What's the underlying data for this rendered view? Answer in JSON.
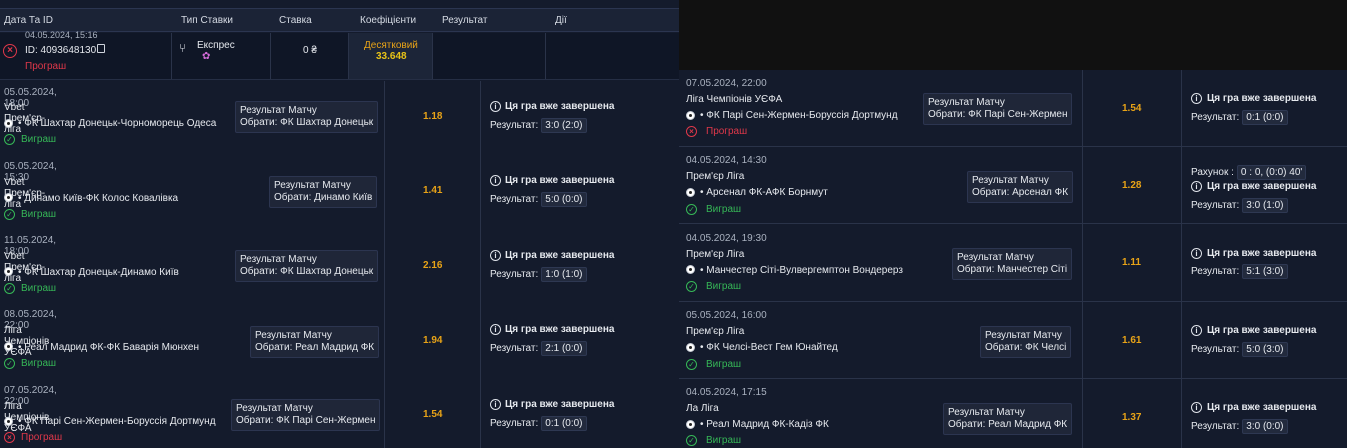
{
  "headers": {
    "date_id": "Дата Та ID",
    "bet_type": "Тип Ставки",
    "stake": "Ставка",
    "coef": "Коефіцієнти",
    "result": "Результат",
    "actions": "Дії"
  },
  "summary": {
    "date": "04.05.2024, 15:16",
    "id": "ID: 4093648130",
    "status": "Програш",
    "type": "Експрес",
    "stake": "0 ₴",
    "coef_label": "Десятковий",
    "coef_value": "33.648"
  },
  "common": {
    "market": "Результат Матчу",
    "choice_prefix": "Обрати:",
    "finished": "Ця гра вже завершена",
    "result_label": "Результат:",
    "win": "Виграш",
    "lose": "Програш"
  },
  "left_rows": [
    {
      "date": "05.05.2024, 18:00",
      "league": "Vbet Прем'єр-ліга",
      "teams": "• ФК Шахтар Донецьк-Чорноморець Одеса",
      "choice": "Обрати: ФК Шахтар Донецьк",
      "odds": "1.18",
      "score": "3:0 (2:0)",
      "status": "Виграш",
      "win": true
    },
    {
      "date": "05.05.2024, 15:30",
      "league": "Vbet Прем'єр-ліга",
      "teams": "• Динамо Київ-ФК Колос Ковалівка",
      "choice": "Обрати: Динамо Київ",
      "odds": "1.41",
      "score": "5:0 (0:0)",
      "status": "Виграш",
      "win": true
    },
    {
      "date": "11.05.2024, 18:00",
      "league": "Vbet Прем'єр-ліга",
      "teams": "• ФК Шахтар Донецьк-Динамо Київ",
      "choice": "Обрати: ФК Шахтар Донецьк",
      "odds": "2.16",
      "score": "1:0 (1:0)",
      "status": "Виграш",
      "win": true
    },
    {
      "date": "08.05.2024, 22:00",
      "league": "Ліга Чемпіонів УЄФА",
      "teams": "• Реал Мадрид ФК-ФК Баварія Мюнхен",
      "choice": "Обрати: Реал Мадрид ФК",
      "odds": "1.94",
      "score": "2:1 (0:0)",
      "status": "Виграш",
      "win": true
    },
    {
      "date": "07.05.2024, 22:00",
      "league": "Ліга Чемпіонів УЄФА",
      "teams": "• ФК Парі Сен-Жермен-Боруссія Дортмунд",
      "choice": "Обрати: ФК Парі Сен-Жермен",
      "odds": "1.54",
      "score": "0:1 (0:0)",
      "status": "Програш",
      "win": false
    }
  ],
  "right_rows": [
    {
      "date": "07.05.2024, 22:00",
      "league": "Ліга Чемпіонів УЄФА",
      "teams": "• ФК Парі Сен-Жермен-Боруссія Дортмунд",
      "choice": "Обрати: ФК Парі Сен-Жермен",
      "odds": "1.54",
      "score": "0:1 (0:0)",
      "status": "Програш",
      "win": false
    },
    {
      "date": "04.05.2024, 14:30",
      "league": "Прем'єр Ліга",
      "teams": "• Арсенал ФК-АФК Борнмут",
      "choice": "Обрати: Арсенал ФК",
      "odds": "1.28",
      "score": "3:0 (1:0)",
      "status": "Виграш",
      "win": true,
      "extra_label": "Рахунок :",
      "extra_value": "0 : 0, (0:0) 40'"
    },
    {
      "date": "04.05.2024, 19:30",
      "league": "Прем'єр Ліга",
      "teams": "• Манчестер Сіті-Вулвергемптон Вондерерз",
      "choice": "Обрати: Манчестер Сіті",
      "odds": "1.11",
      "score": "5:1 (3:0)",
      "status": "Виграш",
      "win": true
    },
    {
      "date": "05.05.2024, 16:00",
      "league": "Прем'єр Ліга",
      "teams": "• ФК Челсі-Вест Гем Юнайтед",
      "choice": "Обрати: ФК Челсі",
      "odds": "1.61",
      "score": "5:0 (3:0)",
      "status": "Виграш",
      "win": true
    },
    {
      "date": "04.05.2024, 17:15",
      "league": "Ла Ліга",
      "teams": "• Реал Мадрид ФК-Кадіз ФК",
      "choice": "Обрати: Реал Мадрид ФК",
      "odds": "1.37",
      "score": "3:0 (0:0)",
      "status": "Виграш",
      "win": true
    }
  ],
  "colors": {
    "win": "#36b857",
    "lose": "#e0384a",
    "odds": "#e8a317",
    "bg": "#141b2c"
  }
}
